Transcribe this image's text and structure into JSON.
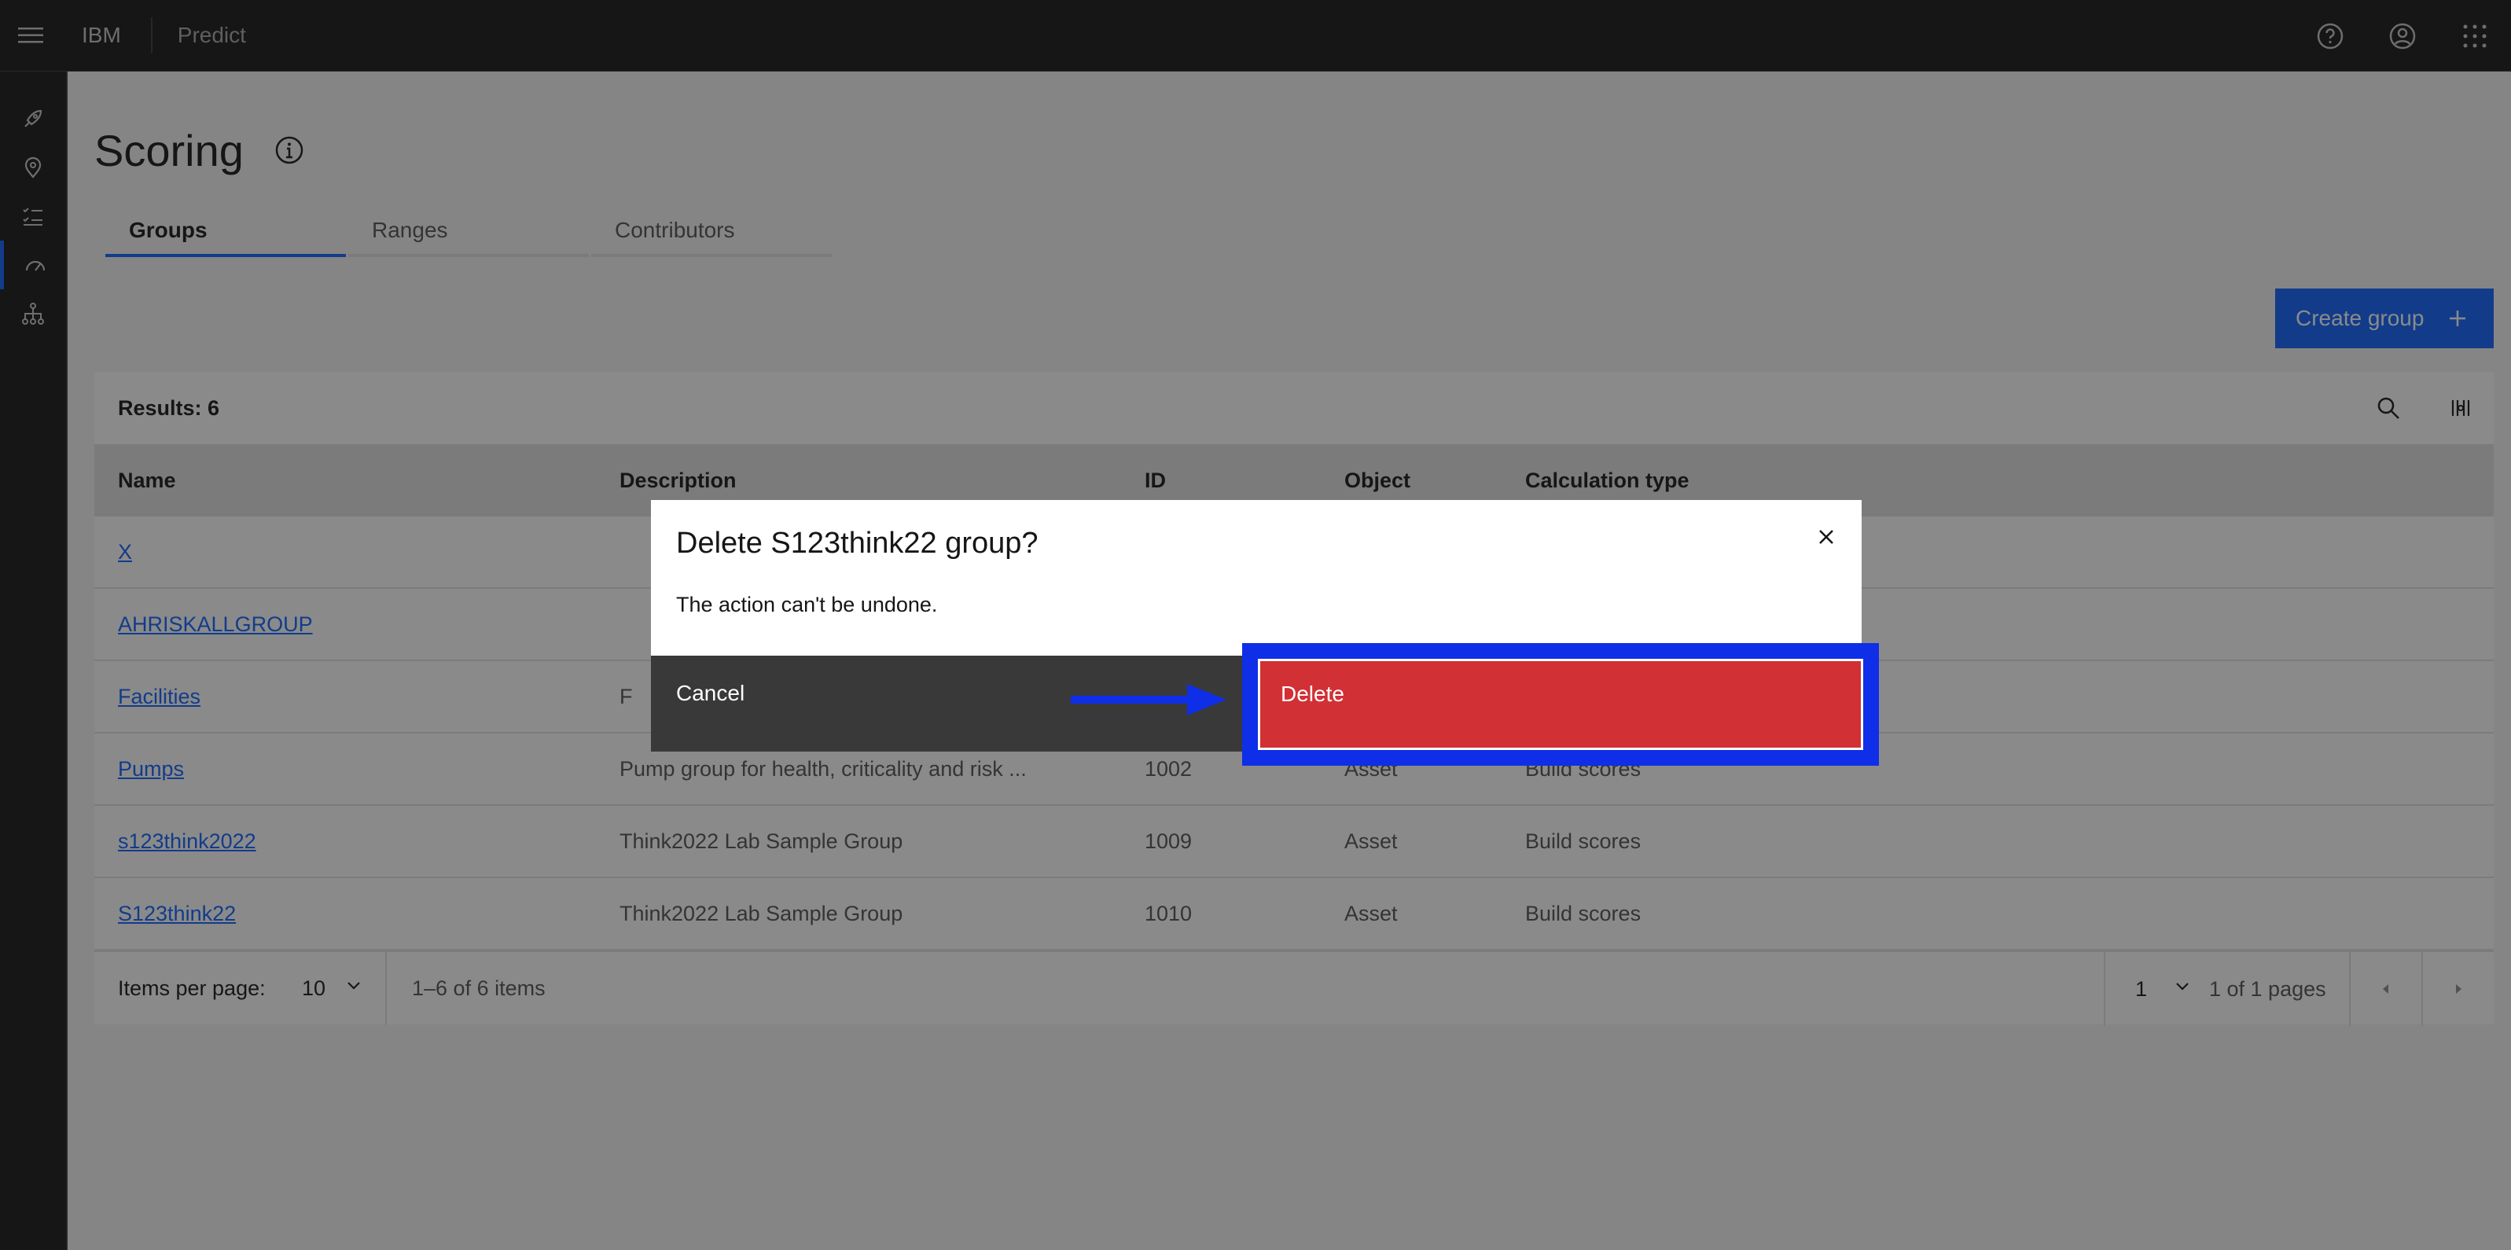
{
  "header": {
    "brand": "IBM",
    "product": "Predict"
  },
  "page": {
    "title": "Scoring"
  },
  "tabs": [
    {
      "label": "Groups"
    },
    {
      "label": "Ranges"
    },
    {
      "label": "Contributors"
    }
  ],
  "actions": {
    "create_group": "Create group"
  },
  "table": {
    "results_label": "Results: 6",
    "columns": [
      "Name",
      "Description",
      "ID",
      "Object",
      "Calculation type"
    ],
    "rows": [
      {
        "name": "X",
        "description": "",
        "id": "",
        "object": "",
        "calc": ""
      },
      {
        "name": "AHRISKALLGROUP",
        "description": "",
        "id": "",
        "object": "",
        "calc": ""
      },
      {
        "name": "Facilities",
        "description": "F",
        "id": "",
        "object": "",
        "calc": ""
      },
      {
        "name": "Pumps",
        "description": "Pump group for health, criticality and risk ...",
        "id": "1002",
        "object": "Asset",
        "calc": "Build scores"
      },
      {
        "name": "s123think2022",
        "description": "Think2022 Lab Sample Group",
        "id": "1009",
        "object": "Asset",
        "calc": "Build scores"
      },
      {
        "name": "S123think22",
        "description": "Think2022 Lab Sample Group",
        "id": "1010",
        "object": "Asset",
        "calc": "Build scores"
      }
    ]
  },
  "pagination": {
    "items_per_page_label": "Items per page:",
    "items_per_page": "10",
    "range": "1–6 of 6 items",
    "page": "1",
    "page_of": "1 of 1 pages"
  },
  "modal": {
    "title": "Delete S123think22 group?",
    "body": "The action can't be undone.",
    "cancel": "Cancel",
    "delete": "Delete"
  },
  "colors": {
    "primary": "#0f62fe",
    "danger": "#da1e28",
    "annotation": "#0f2ee8"
  }
}
